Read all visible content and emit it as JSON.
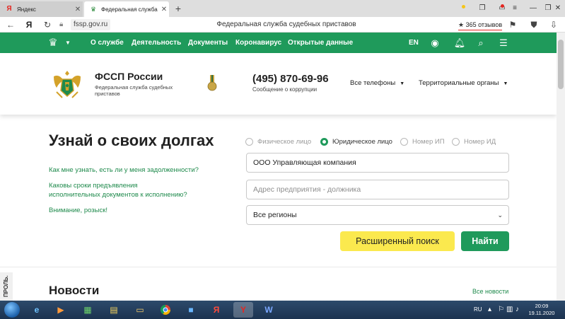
{
  "browser": {
    "tabs": [
      {
        "title": "Яндекс",
        "favicon": "yandex-y"
      },
      {
        "title": "Федеральная служба с",
        "favicon": "fssp-emblem"
      }
    ],
    "url": "fssp.gov.ru",
    "page_title": "Федеральная служба судебных приставов",
    "reviews_label": "365 отзывов",
    "reviews_star": "★"
  },
  "site_nav": {
    "items": [
      "О службе",
      "Деятельность",
      "Документы",
      "Коронавирус",
      "Открытые данные"
    ],
    "lang": "EN"
  },
  "header": {
    "org_name": "ФССП России",
    "org_sub": "Федеральная служба судебных приставов",
    "phone": "(495) 870-69-96",
    "phone_sub": "Сообщение о коррупции",
    "all_phones": "Все телефоны",
    "territorial": "Территориальные органы"
  },
  "search": {
    "heading": "Узнай о своих долгах",
    "links": [
      "Как мне узнать, есть ли у меня задолженности?",
      "Каковы сроки предъявления исполнительных документов к исполнению?",
      "Внимание, розыск!"
    ],
    "radios": [
      {
        "label": "Физическое лицо",
        "checked": false
      },
      {
        "label": "Юридическое лицо",
        "checked": true
      },
      {
        "label": "Номер ИП",
        "checked": false
      },
      {
        "label": "Номер ИД",
        "checked": false
      }
    ],
    "company_value": "ООО Управляющая компания",
    "address_placeholder": "Адрес предприятия - должника",
    "region_value": "Все регионы",
    "advanced_label": "Расширенный поиск",
    "find_label": "Найти"
  },
  "news": {
    "heading": "Новости",
    "all_label": "Все новости",
    "side_tab": "ПРОЛЬ."
  },
  "taskbar": {
    "lang": "RU",
    "time": "20:09",
    "date": "19.11.2020"
  },
  "colors": {
    "brand_green": "#1f9a5b",
    "accent_yellow": "#fbe94e",
    "link_green": "#1f8a4c"
  }
}
